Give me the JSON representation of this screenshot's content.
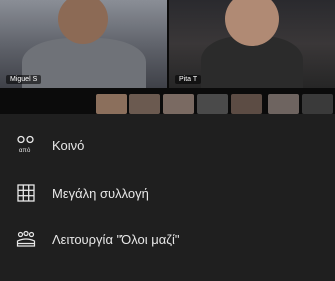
{
  "participants": [
    {
      "name": "Miguel S"
    },
    {
      "name": "Pita T"
    }
  ],
  "menu": {
    "items": [
      {
        "label": "Κοινό",
        "icon": "audience-view-icon",
        "icon_caption": "από"
      },
      {
        "label": "Μεγάλη συλλογή",
        "icon": "large-gallery-grid-icon"
      },
      {
        "label": "Λειτουργία \"Όλοι μαζί\"",
        "icon": "together-mode-icon"
      }
    ]
  },
  "colors": {
    "sheet_background": "#1f1f1f",
    "text": "#e8e8e8"
  }
}
